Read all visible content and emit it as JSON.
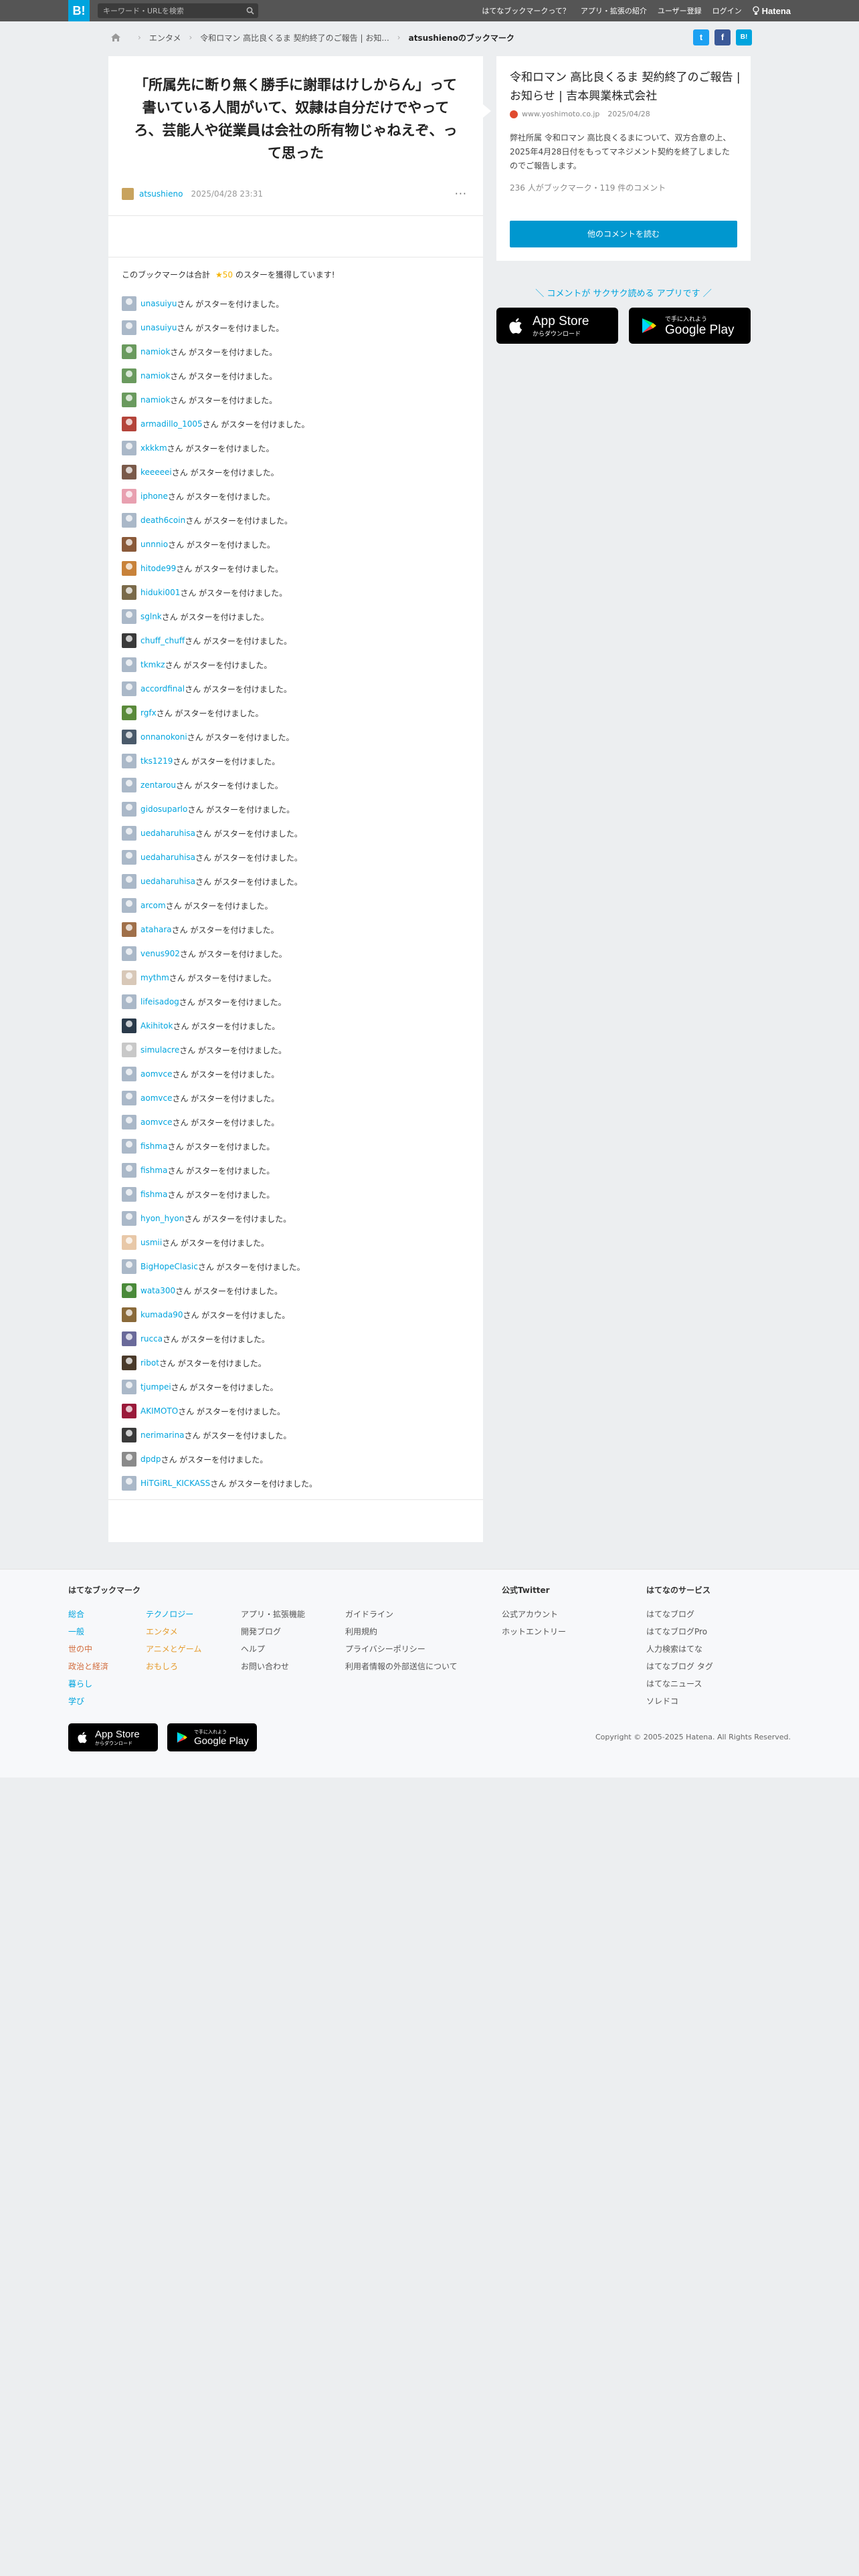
{
  "header": {
    "logo": "B!",
    "search_placeholder": "キーワード・URLを検索",
    "nav": [
      "はてなブックマークって？",
      "アプリ・拡張の紹介",
      "ユーザー登録",
      "ログイン"
    ],
    "brand": "Hatena"
  },
  "breadcrumb": {
    "items": [
      "エンタメ",
      "令和ロマン 高比良くるま 契約終了のご報告 | お知..."
    ],
    "current": "atsushienoのブックマーク"
  },
  "share": {
    "twitter": "t",
    "facebook": "f",
    "hatena": "B!"
  },
  "bookmark": {
    "comment": "「所属先に断り無く勝手に謝罪はけしからん」って書いている人間がいて、奴隷は自分だけでやってろ、芸能人や従業員は会社の所有物じゃねえぞ、って思った",
    "user": "atsushieno",
    "date": "2025/04/28 23:31",
    "more": "···",
    "summary_prefix": "このブックマークは合計",
    "star_count": "★50",
    "summary_suffix": "のスターを獲得しています!"
  },
  "star_suffix": "さん がスターを付けました。",
  "stars": [
    {
      "name": "unasuiyu",
      "color": "#aab8c8"
    },
    {
      "name": "unasuiyu",
      "color": "#aab8c8"
    },
    {
      "name": "namiok",
      "color": "#6a9a5e"
    },
    {
      "name": "namiok",
      "color": "#6a9a5e"
    },
    {
      "name": "namiok",
      "color": "#6a9a5e"
    },
    {
      "name": "armadillo_1005",
      "color": "#b4443a"
    },
    {
      "name": "xkkkm",
      "color": "#aab8c8"
    },
    {
      "name": "keeeeei",
      "color": "#7a5a4a"
    },
    {
      "name": "iphone",
      "color": "#e8a0b0"
    },
    {
      "name": "death6coin",
      "color": "#aab8c8"
    },
    {
      "name": "unnnio",
      "color": "#8a5a3a"
    },
    {
      "name": "hitode99",
      "color": "#c8823a"
    },
    {
      "name": "hiduki001",
      "color": "#7a6a4a"
    },
    {
      "name": "sglnk",
      "color": "#aab8c8"
    },
    {
      "name": "chuff_chuff",
      "color": "#3a3a3a"
    },
    {
      "name": "tkmkz",
      "color": "#aab8c8"
    },
    {
      "name": "accordfinal",
      "color": "#aab8c8"
    },
    {
      "name": "rgfx",
      "color": "#5a8a3a"
    },
    {
      "name": "onnanokoni",
      "color": "#4a5a6a"
    },
    {
      "name": "tks1219",
      "color": "#aab8c8"
    },
    {
      "name": "zentarou",
      "color": "#aab8c8"
    },
    {
      "name": "gidosuparlo",
      "color": "#aab8c8"
    },
    {
      "name": "uedaharuhisa",
      "color": "#aab8c8"
    },
    {
      "name": "uedaharuhisa",
      "color": "#aab8c8"
    },
    {
      "name": "uedaharuhisa",
      "color": "#aab8c8"
    },
    {
      "name": "arcom",
      "color": "#aab8c8"
    },
    {
      "name": "atahara",
      "color": "#a0704a"
    },
    {
      "name": "venus902",
      "color": "#aab8c8"
    },
    {
      "name": "mythm",
      "color": "#d8c8b8"
    },
    {
      "name": "lifeisadog",
      "color": "#aab8c8"
    },
    {
      "name": "Akihitok",
      "color": "#2a3a4a"
    },
    {
      "name": "simulacre",
      "color": "#c8c8c8"
    },
    {
      "name": "aomvce",
      "color": "#aab8c8"
    },
    {
      "name": "aomvce",
      "color": "#aab8c8"
    },
    {
      "name": "aomvce",
      "color": "#aab8c8"
    },
    {
      "name": "fishma",
      "color": "#aab8c8"
    },
    {
      "name": "fishma",
      "color": "#aab8c8"
    },
    {
      "name": "fishma",
      "color": "#aab8c8"
    },
    {
      "name": "hyon_hyon",
      "color": "#aab8c8"
    },
    {
      "name": "usmii",
      "color": "#e8c8a8"
    },
    {
      "name": "BigHopeClasic",
      "color": "#aab8c8"
    },
    {
      "name": "wata300",
      "color": "#4a8a3a"
    },
    {
      "name": "kumada90",
      "color": "#8a6a3a"
    },
    {
      "name": "rucca",
      "color": "#6a6a9a"
    },
    {
      "name": "ribot",
      "color": "#4a3a2a"
    },
    {
      "name": "tjumpei",
      "color": "#aab8c8"
    },
    {
      "name": "AKIMOTO",
      "color": "#9a1a3a"
    },
    {
      "name": "nerimarina",
      "color": "#3a3a3a"
    },
    {
      "name": "dpdp",
      "color": "#8a8a8a"
    },
    {
      "name": "HiTGiRL_KICKASS",
      "color": "#aab8c8"
    }
  ],
  "entry": {
    "title": "令和ロマン 高比良くるま 契約終了のご報告 | お知らせ | 吉本興業株式会社",
    "domain": "www.yoshimoto.co.jp",
    "date": "2025/04/28",
    "description": "弊社所属 令和ロマン 高比良くるまについて、双方合意の上、2025年4月28日付をもってマネジメント契約を終了しましたのでご報告します。",
    "meta": "236 人がブックマーク・119 件のコメント",
    "button": "他のコメントを読む"
  },
  "promo": {
    "text": "＼ コメントが サクサク読める アプリです ／",
    "appstore_small": "からダウンロード",
    "appstore_big": "App Store",
    "googleplay_small": "で手に入れよう",
    "googleplay_big": "Google Play"
  },
  "footer": {
    "bookmark_heading": "はてなブックマーク",
    "col1": [
      "総合",
      "一般",
      "世の中",
      "政治と経済",
      "暮らし",
      "学び"
    ],
    "col2": [
      "テクノロジー",
      "エンタメ",
      "アニメとゲーム",
      "おもしろ"
    ],
    "col3": [
      "アプリ・拡張機能",
      "開発ブログ",
      "ヘルプ",
      "お問い合わせ"
    ],
    "col4": [
      "ガイドライン",
      "利用規約",
      "プライバシーポリシー",
      "利用者情報の外部送信について"
    ],
    "twitter_heading": "公式Twitter",
    "col5": [
      "公式アカウント",
      "ホットエントリー"
    ],
    "services_heading": "はてなのサービス",
    "col6": [
      "はてなブログ",
      "はてなブログPro",
      "人力検索はてな",
      "はてなブログ タグ",
      "はてなニュース",
      "ソレドコ"
    ],
    "copyright": "Copyright © 2005-2025 Hatena. All Rights Reserved."
  },
  "colors": {
    "accent": "#00a4de",
    "header": "#555555",
    "button": "#0097cf",
    "star": "#f5b301"
  }
}
